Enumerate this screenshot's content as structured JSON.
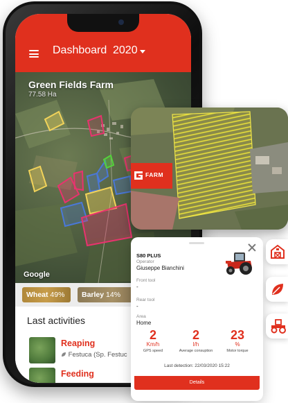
{
  "app": {
    "title": "Dashboard",
    "year": "2020"
  },
  "farm": {
    "name": "Green Fields Farm",
    "area": "77.58 Ha"
  },
  "map": {
    "attribution": "Google"
  },
  "crops": [
    {
      "label": "Wheat",
      "percent": "49%"
    },
    {
      "label": "Barley",
      "percent": "14%"
    }
  ],
  "activities": {
    "title": "Last activities",
    "items": [
      {
        "name": "Reaping",
        "detail": "Festuca (Sp. Festuc"
      },
      {
        "name": "Feeding",
        "detail": ""
      }
    ]
  },
  "overlay": {
    "badge": "FARM"
  },
  "machine": {
    "model": "S80 PLUS",
    "operator_label": "Operator",
    "operator": "Giuseppe Bianchini",
    "front_tool_label": "Front tool",
    "front_tool": "-",
    "rear_tool_label": "Rear tool",
    "rear_tool": "-",
    "area_label": "Area",
    "area": "Home",
    "stats": [
      {
        "value": "2",
        "unit": "Km/h",
        "label": "GPS speed"
      },
      {
        "value": "2",
        "unit": "l/h",
        "label": "Average consuption"
      },
      {
        "value": "23",
        "unit": "%",
        "label": "Motor torque"
      }
    ],
    "last_detection": "Last detection: 22/03/2020 15:22",
    "details_button": "Details"
  },
  "side_actions": [
    {
      "icon": "barn-icon"
    },
    {
      "icon": "leaf-icon"
    },
    {
      "icon": "tractor-icon"
    }
  ],
  "colors": {
    "brand_red": "#e0301e",
    "field_yellow": "#f2d35a",
    "field_pink": "#e8336e",
    "field_blue": "#4a78d8",
    "field_green": "#55d23c"
  }
}
